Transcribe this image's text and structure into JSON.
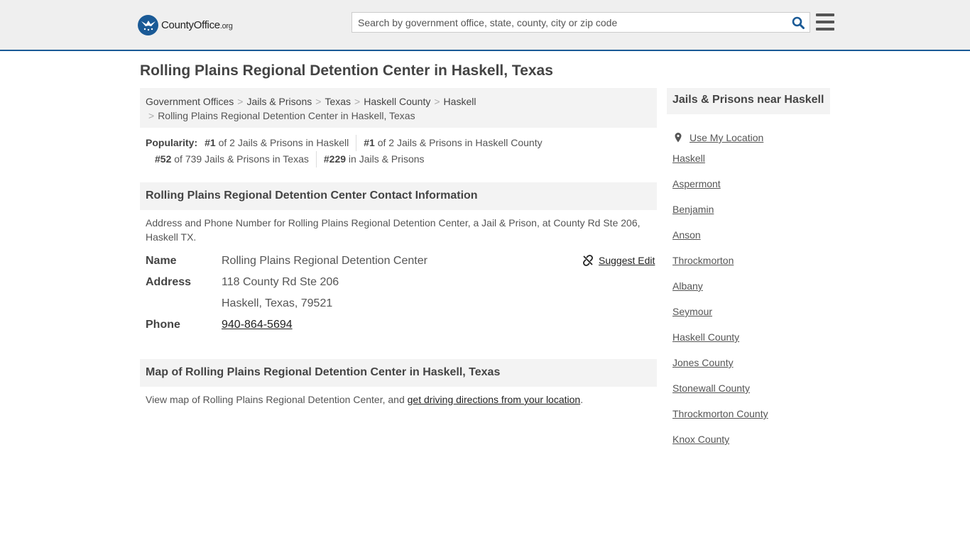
{
  "header": {
    "logo_text": "CountyOffice",
    "logo_suffix": ".org",
    "search_placeholder": "Search by government office, state, county, city or zip code"
  },
  "page_title": "Rolling Plains Regional Detention Center in Haskell, Texas",
  "breadcrumb": {
    "items": [
      "Government Offices",
      "Jails & Prisons",
      "Texas",
      "Haskell County",
      "Haskell"
    ],
    "current": "Rolling Plains Regional Detention Center in Haskell, Texas"
  },
  "popularity": {
    "label": "Popularity:",
    "items": [
      {
        "rank": "#1",
        "text": " of 2 Jails & Prisons in Haskell"
      },
      {
        "rank": "#1",
        "text": " of 2 Jails & Prisons in Haskell County"
      },
      {
        "rank": "#52",
        "text": " of 739 Jails & Prisons in Texas"
      },
      {
        "rank": "#229",
        "text": " in Jails & Prisons"
      }
    ]
  },
  "contact": {
    "heading": "Rolling Plains Regional Detention Center Contact Information",
    "description": "Address and Phone Number for Rolling Plains Regional Detention Center, a Jail & Prison, at County Rd Ste 206, Haskell TX.",
    "suggest_edit": "Suggest Edit",
    "name_label": "Name",
    "name": "Rolling Plains Regional Detention Center",
    "address_label": "Address",
    "address_line1": "118 County Rd Ste 206",
    "address_line2": "Haskell, Texas, 79521",
    "phone_label": "Phone",
    "phone": "940-864-5694"
  },
  "map": {
    "heading": "Map of Rolling Plains Regional Detention Center in Haskell, Texas",
    "text_before": "View map of Rolling Plains Regional Detention Center, and ",
    "link": "get driving directions from your location",
    "text_after": "."
  },
  "sidebar": {
    "heading": "Jails & Prisons near Haskell",
    "use_location": "Use My Location",
    "links": [
      "Haskell",
      "Aspermont",
      "Benjamin",
      "Anson",
      "Throckmorton",
      "Albany",
      "Seymour",
      "Haskell County",
      "Jones County",
      "Stonewall County",
      "Throckmorton County",
      "Knox County"
    ]
  }
}
